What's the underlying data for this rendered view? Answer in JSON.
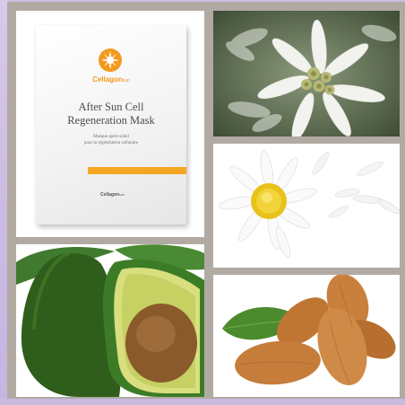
{
  "product": {
    "brand": "Cellagon",
    "brand_sub": "sun",
    "title_line1": "After Sun Cell",
    "title_line2": "Regeneration Mask",
    "subtitle_line1": "Masque après soleil",
    "subtitle_line2": "pour la régénération cellulaire",
    "bottom_brand": "Cellagon",
    "bottom_brand_sub": "sun"
  },
  "colors": {
    "brand_orange": "#f29a1f",
    "frame": "#b1aaa3",
    "background": "#c9bfe0"
  },
  "tiles": [
    {
      "name": "after-sun-mask-packet",
      "icon": "mask-packet-image"
    },
    {
      "name": "edelweiss-flower",
      "icon": "edelweiss-image"
    },
    {
      "name": "chamomile-daisy",
      "icon": "daisy-image"
    },
    {
      "name": "avocado",
      "icon": "avocado-image"
    },
    {
      "name": "almonds",
      "icon": "almond-image"
    }
  ]
}
